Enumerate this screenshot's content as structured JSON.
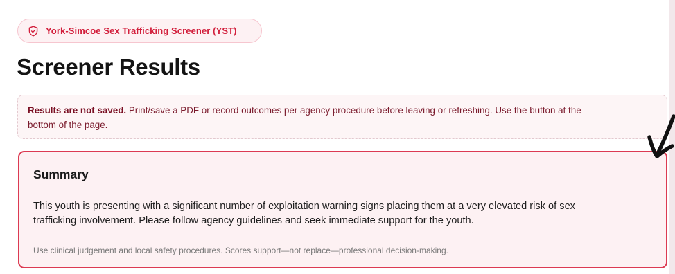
{
  "badge": {
    "icon": "shield-check-icon",
    "label": "York-Simcoe Sex Trafficking Screener (YST)",
    "color": "#d21f3c"
  },
  "page_title": "Screener Results",
  "notice": {
    "strong": "Results are not saved.",
    "line1_rest": " Print/save a PDF or record outcomes per agency procedure before leaving or refreshing. Use the button at the",
    "line2": "bottom of the page."
  },
  "summary": {
    "heading": "Summary",
    "body_line1": "This youth is presenting with a significant number of exploitation warning signs placing them at a very elevated risk of sex",
    "body_line2": "trafficking involvement. Please follow agency guidelines and seek immediate support for the youth.",
    "note": "Use clinical judgement and local safety procedures. Scores support—not replace—professional decision-making.",
    "border_color": "#dc3a52"
  },
  "annotation": {
    "icon": "hand-drawn-arrow-icon"
  }
}
